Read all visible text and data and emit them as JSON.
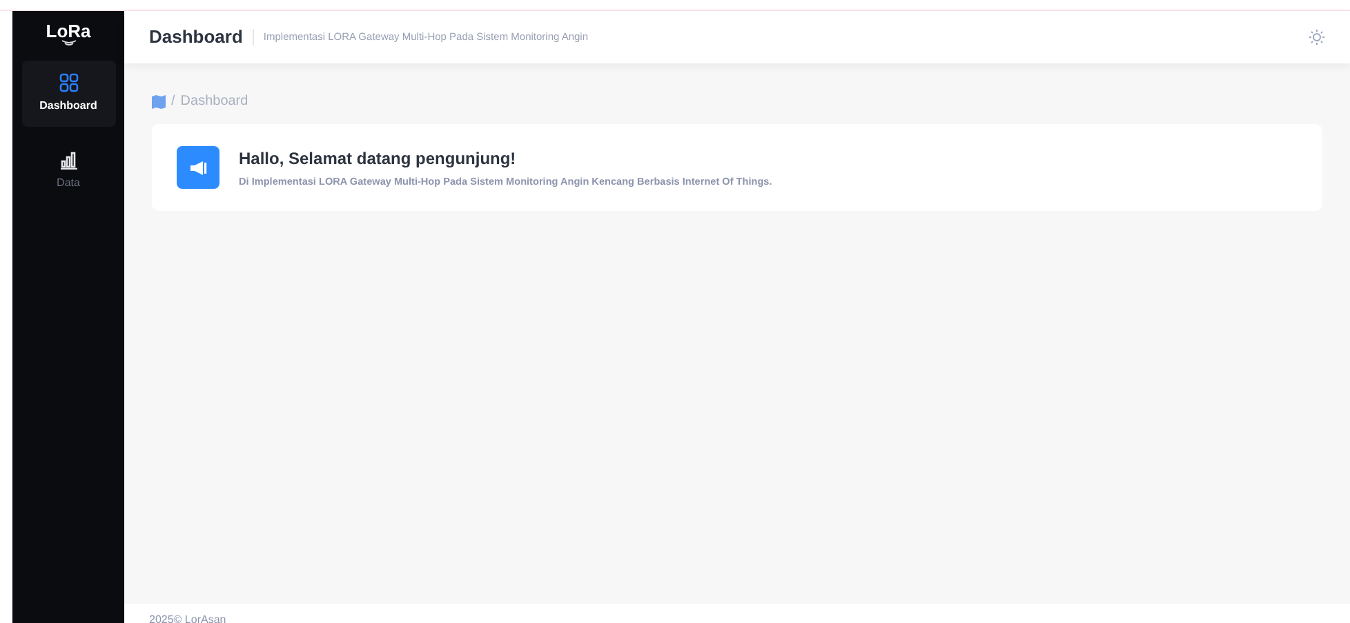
{
  "sidebar": {
    "logo": "LoRa",
    "items": [
      {
        "label": "Dashboard",
        "kind": "grid",
        "selected": true
      },
      {
        "label": "Data",
        "kind": "chart",
        "selected": false
      }
    ]
  },
  "header": {
    "title": "Dashboard",
    "subtitle": "Implementasi LORA Gateway Multi-Hop Pada Sistem Monitoring Angin"
  },
  "breadcrumb": {
    "separator": "/",
    "current": "Dashboard"
  },
  "welcome": {
    "title": "Hallo, Selamat datang pengunjung!",
    "text": "Di Implementasi LORA Gateway Multi-Hop Pada Sistem Monitoring Angin Kencang Berbasis Internet Of Things."
  },
  "footer": {
    "text": "2025© LorAsan"
  }
}
